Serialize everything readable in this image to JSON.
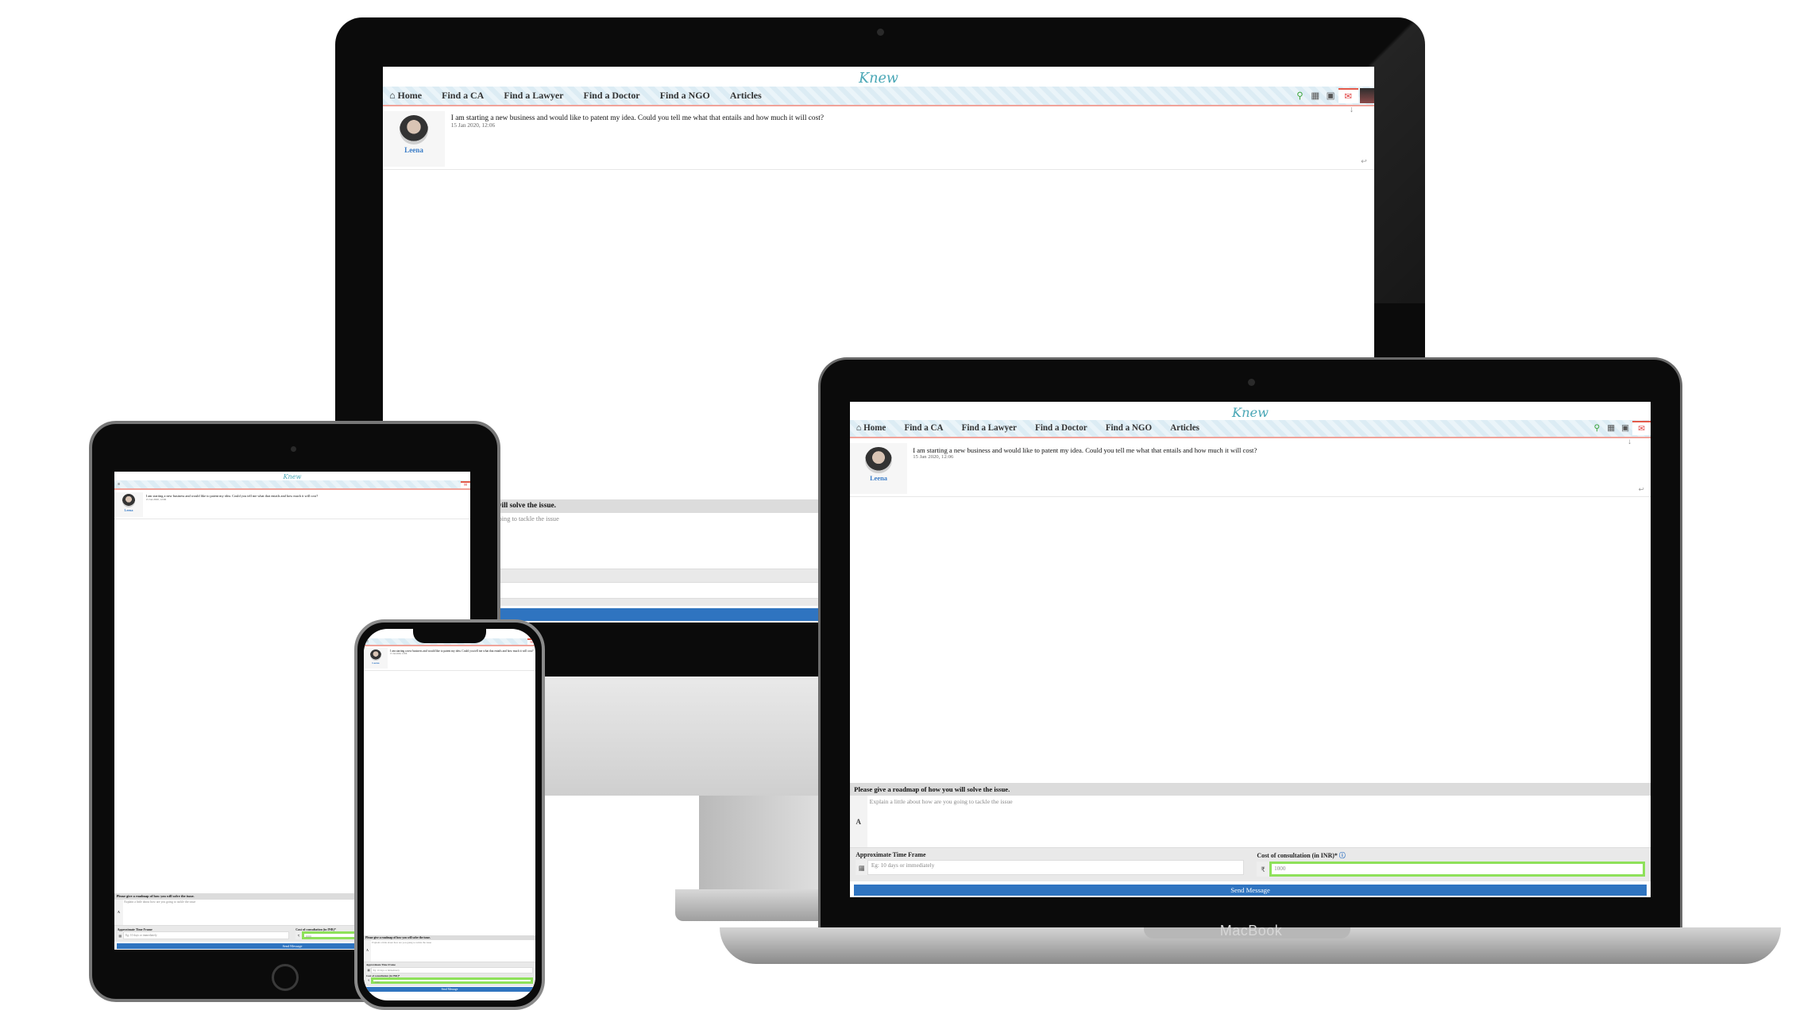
{
  "brand": {
    "logo_text": "Knew"
  },
  "nav": {
    "items": [
      "Home",
      "Find a CA",
      "Find a Lawyer",
      "Find a Doctor",
      "Find a NGO",
      "Articles"
    ],
    "icons": [
      "search-icon",
      "calendar-icon",
      "calendar-check-icon",
      "mail-icon"
    ]
  },
  "message": {
    "author": "Leena",
    "text": "I am starting a new business and would like to patent my idea. Could you tell me what that entails and how much it will cost?",
    "date": "15 Jan 2020, 12:06"
  },
  "form": {
    "roadmap_label": "Please give a roadmap of how you will solve the issue.",
    "roadmap_placeholder": "Explain a little about how are you going to tackle the issue",
    "timeframe_label": "Approximate Time Frame",
    "timeframe_placeholder": "Eg: 10 days or immediately",
    "cost_label": "Cost of consultation (in INR)*",
    "cost_value": "1000",
    "currency_symbol": "₹",
    "send_label": "Send Message"
  },
  "device": {
    "macbook_label": "MacBook"
  },
  "colors": {
    "nav_border": "#f0a39a",
    "send_button": "#2f74c0",
    "highlight": "#8ee15a",
    "author": "#3a7cc7"
  }
}
